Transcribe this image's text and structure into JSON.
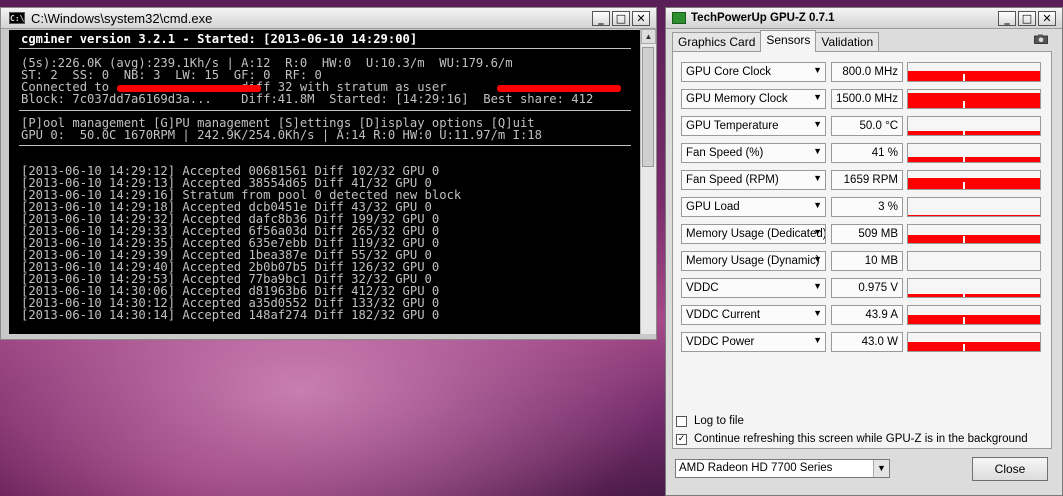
{
  "cmd": {
    "title": "C:\\Windows\\system32\\cmd.exe",
    "header_line": "cgminer version 3.2.1 - Started: [2013-06-10 14:29:00]",
    "status_lines": [
      "(5s):226.0K (avg):239.1Kh/s | A:12  R:0  HW:0  U:10.3/m  WU:179.6/m",
      "ST: 2  SS: 0  NB: 3  LW: 15  GF: 0  RF: 0",
      "Connected to                  diff 32 with stratum as user",
      "Block: 7c037dd7a6169d3a...    Diff:41.8M  Started: [14:29:16]  Best share: 412"
    ],
    "menu_line": "[P]ool management [G]PU management [S]ettings [D]isplay options [Q]uit",
    "gpu_line": "GPU 0:  50.0C 1670RPM | 242.9K/254.0Kh/s | A:14 R:0 HW:0 U:11.97/m I:18",
    "log_lines": [
      "[2013-06-10 14:29:12] Accepted 00681561 Diff 102/32 GPU 0",
      "[2013-06-10 14:29:13] Accepted 38554d65 Diff 41/32 GPU 0",
      "[2013-06-10 14:29:16] Stratum from pool 0 detected new block",
      "[2013-06-10 14:29:18] Accepted dcb0451e Diff 43/32 GPU 0",
      "[2013-06-10 14:29:32] Accepted dafc8b36 Diff 199/32 GPU 0",
      "[2013-06-10 14:29:33] Accepted 6f56a03d Diff 265/32 GPU 0",
      "[2013-06-10 14:29:35] Accepted 635e7ebb Diff 119/32 GPU 0",
      "[2013-06-10 14:29:39] Accepted 1bea387e Diff 55/32 GPU 0",
      "[2013-06-10 14:29:40] Accepted 2b0b07b5 Diff 126/32 GPU 0",
      "[2013-06-10 14:29:53] Accepted 77ba9bc1 Diff 32/32 GPU 0",
      "[2013-06-10 14:30:06] Accepted d81963b6 Diff 412/32 GPU 0",
      "[2013-06-10 14:30:12] Accepted a35d0552 Diff 133/32 GPU 0",
      "[2013-06-10 14:30:14] Accepted 148af274 Diff 182/32 GPU 0"
    ]
  },
  "gpuz": {
    "title": "TechPowerUp GPU-Z 0.7.1",
    "tabs": [
      "Graphics Card",
      "Sensors",
      "Validation"
    ],
    "active_tab": "Sensors",
    "graph_color": "#ff0000",
    "sensors": [
      {
        "name": "GPU Core Clock",
        "value": "800.0 MHz",
        "graph_level": 0.55
      },
      {
        "name": "GPU Memory Clock",
        "value": "1500.0 MHz",
        "graph_level": 0.85
      },
      {
        "name": "GPU Temperature",
        "value": "50.0 °C",
        "graph_level": 0.2
      },
      {
        "name": "Fan Speed (%)",
        "value": "41 %",
        "graph_level": 0.3
      },
      {
        "name": "Fan Speed (RPM)",
        "value": "1659 RPM",
        "graph_level": 0.6
      },
      {
        "name": "GPU Load",
        "value": "3 %",
        "graph_level": 0.05
      },
      {
        "name": "Memory Usage (Dedicated)",
        "value": "509 MB",
        "graph_level": 0.45
      },
      {
        "name": "Memory Usage (Dynamic)",
        "value": "10 MB",
        "graph_level": 0.0
      },
      {
        "name": "VDDC",
        "value": "0.975 V",
        "graph_level": 0.15
      },
      {
        "name": "VDDC Current",
        "value": "43.9 A",
        "graph_level": 0.5
      },
      {
        "name": "VDDC Power",
        "value": "43.0 W",
        "graph_level": 0.5
      }
    ],
    "log_to_file_label": "Log to file",
    "log_to_file_checked": false,
    "continue_refresh_label": "Continue refreshing this screen while GPU-Z is in the background",
    "continue_refresh_checked": true,
    "selected_gpu": "AMD Radeon HD 7700 Series",
    "close_label": "Close"
  }
}
